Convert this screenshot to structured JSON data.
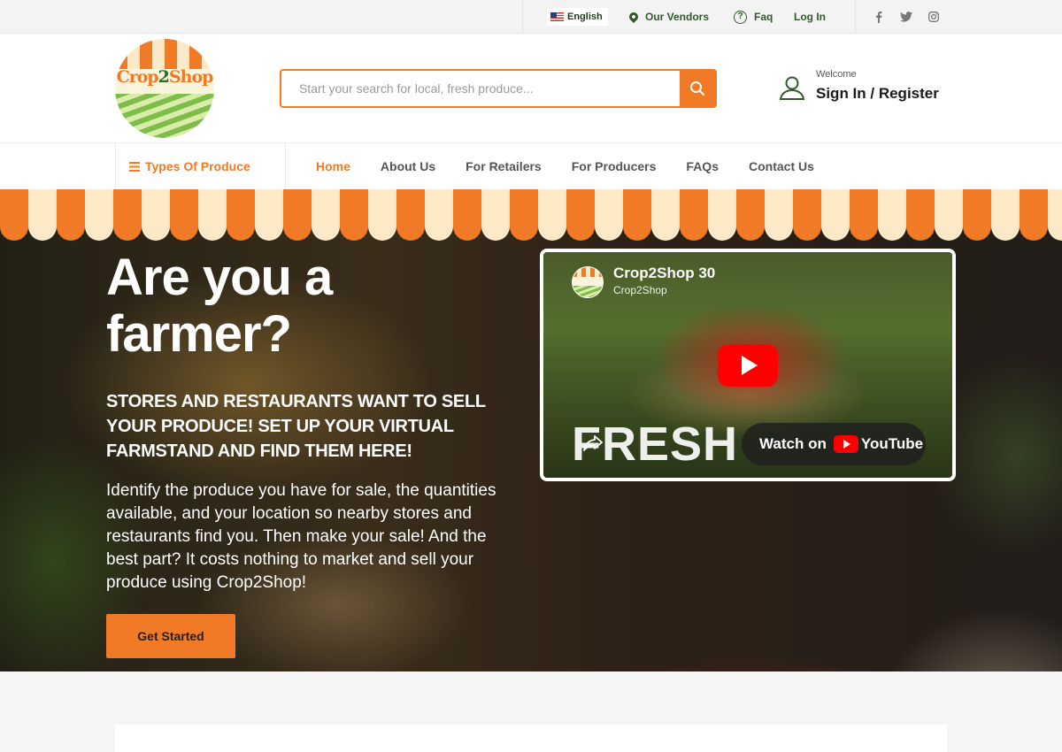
{
  "topbar": {
    "language": "English",
    "vendors": "Our Vendors",
    "faq": "Faq",
    "login": "Log In",
    "social": [
      "f",
      "t",
      "ig"
    ]
  },
  "header": {
    "logo_text_a": "Crop",
    "logo_text_b": "2",
    "logo_text_c": "Shop",
    "search_placeholder": "Start your search for local, fresh produce...",
    "welcome": "Welcome",
    "signin": "Sign In / Register"
  },
  "nav": {
    "category": "Types Of Produce",
    "items": [
      "Home",
      "About Us",
      "For Retailers",
      "For Producers",
      "FAQs",
      "Contact Us"
    ]
  },
  "hero": {
    "title": "Are you a farmer?",
    "subtitle": "STORES AND RESTAURANTS WANT TO SELL YOUR PRODUCE! SET UP YOUR VIRTUAL FARMSTAND AND FIND THEM HERE!",
    "body": "Identify the produce you have for sale, the quantities available, and your location so nearby stores and restaurants find you. Then make your sale! And the best part? It costs nothing to market and sell your produce using Crop2Shop!",
    "cta": "Get Started"
  },
  "video": {
    "title": "Crop2Shop 30",
    "channel": "Crop2Shop",
    "overlay_text": "FRESH",
    "watch_label": "Watch on",
    "youtube_label": "YouTube"
  },
  "colors": {
    "accent": "#f07a25",
    "green": "#2f5b2a",
    "cream": "#fde9c8"
  }
}
